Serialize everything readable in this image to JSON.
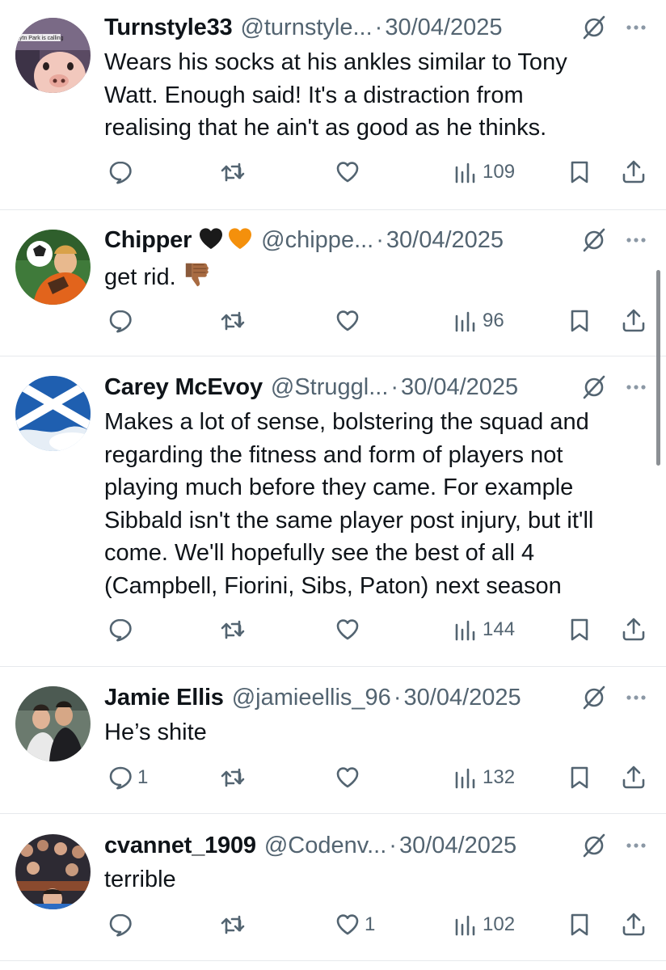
{
  "posts": [
    {
      "name": "Turnstyle33",
      "handle": "@turnstyle...",
      "separator": "·",
      "date": "30/04/2025",
      "avatar_caption": "Aytn Park is calling",
      "lines": [
        "Wears his socks at his ankles similar to Tony",
        "Watt. Enough said! It's a distraction from",
        "realising that he ain't as good as he thinks."
      ],
      "counts": {
        "replies": "",
        "reposts": "",
        "likes": "",
        "views": "109"
      }
    },
    {
      "name": "Chipper",
      "name_emoji": [
        "black-heart-icon",
        "orange-heart-icon"
      ],
      "handle": "@chippe...",
      "separator": "·",
      "date": "30/04/2025",
      "lines": [
        "get rid."
      ],
      "inline_emoji": "thumbs-down-icon",
      "counts": {
        "replies": "",
        "reposts": "",
        "likes": "",
        "views": "96"
      }
    },
    {
      "name": "Carey McEvoy",
      "handle": "@Struggl...",
      "separator": "·",
      "date": "30/04/2025",
      "lines": [
        "Makes a lot of sense, bolstering the squad and",
        "regarding the fitness and form of players not",
        "playing much before they came. For example",
        "Sibbald isn't the same player post injury, but it'll",
        "come. We'll hopefully see the best of all 4",
        "(Campbell, Fiorini, Sibs, Paton) next season"
      ],
      "counts": {
        "replies": "",
        "reposts": "",
        "likes": "",
        "views": "144"
      }
    },
    {
      "name": "Jamie Ellis",
      "handle": "@jamieellis_96",
      "separator": "·",
      "date": "30/04/2025",
      "lines": [
        "He’s shite"
      ],
      "counts": {
        "replies": "1",
        "reposts": "",
        "likes": "",
        "views": "132"
      }
    },
    {
      "name": "cvannet_1909",
      "handle": "@Codenv...",
      "separator": "·",
      "date": "30/04/2025",
      "lines": [
        "terrible"
      ],
      "counts": {
        "replies": "",
        "reposts": "",
        "likes": "1",
        "views": "102"
      }
    }
  ],
  "icons": {
    "reply": "reply-icon",
    "repost": "repost-icon",
    "like": "like-icon",
    "views": "views-icon",
    "bookmark": "bookmark-icon",
    "share": "share-icon",
    "grok": "grok-icon",
    "more": "more-icon"
  },
  "colors": {
    "text": "#0f1419",
    "secondary": "#536471",
    "divider": "#e6e9ec",
    "orange_heart": "#f4900c"
  }
}
